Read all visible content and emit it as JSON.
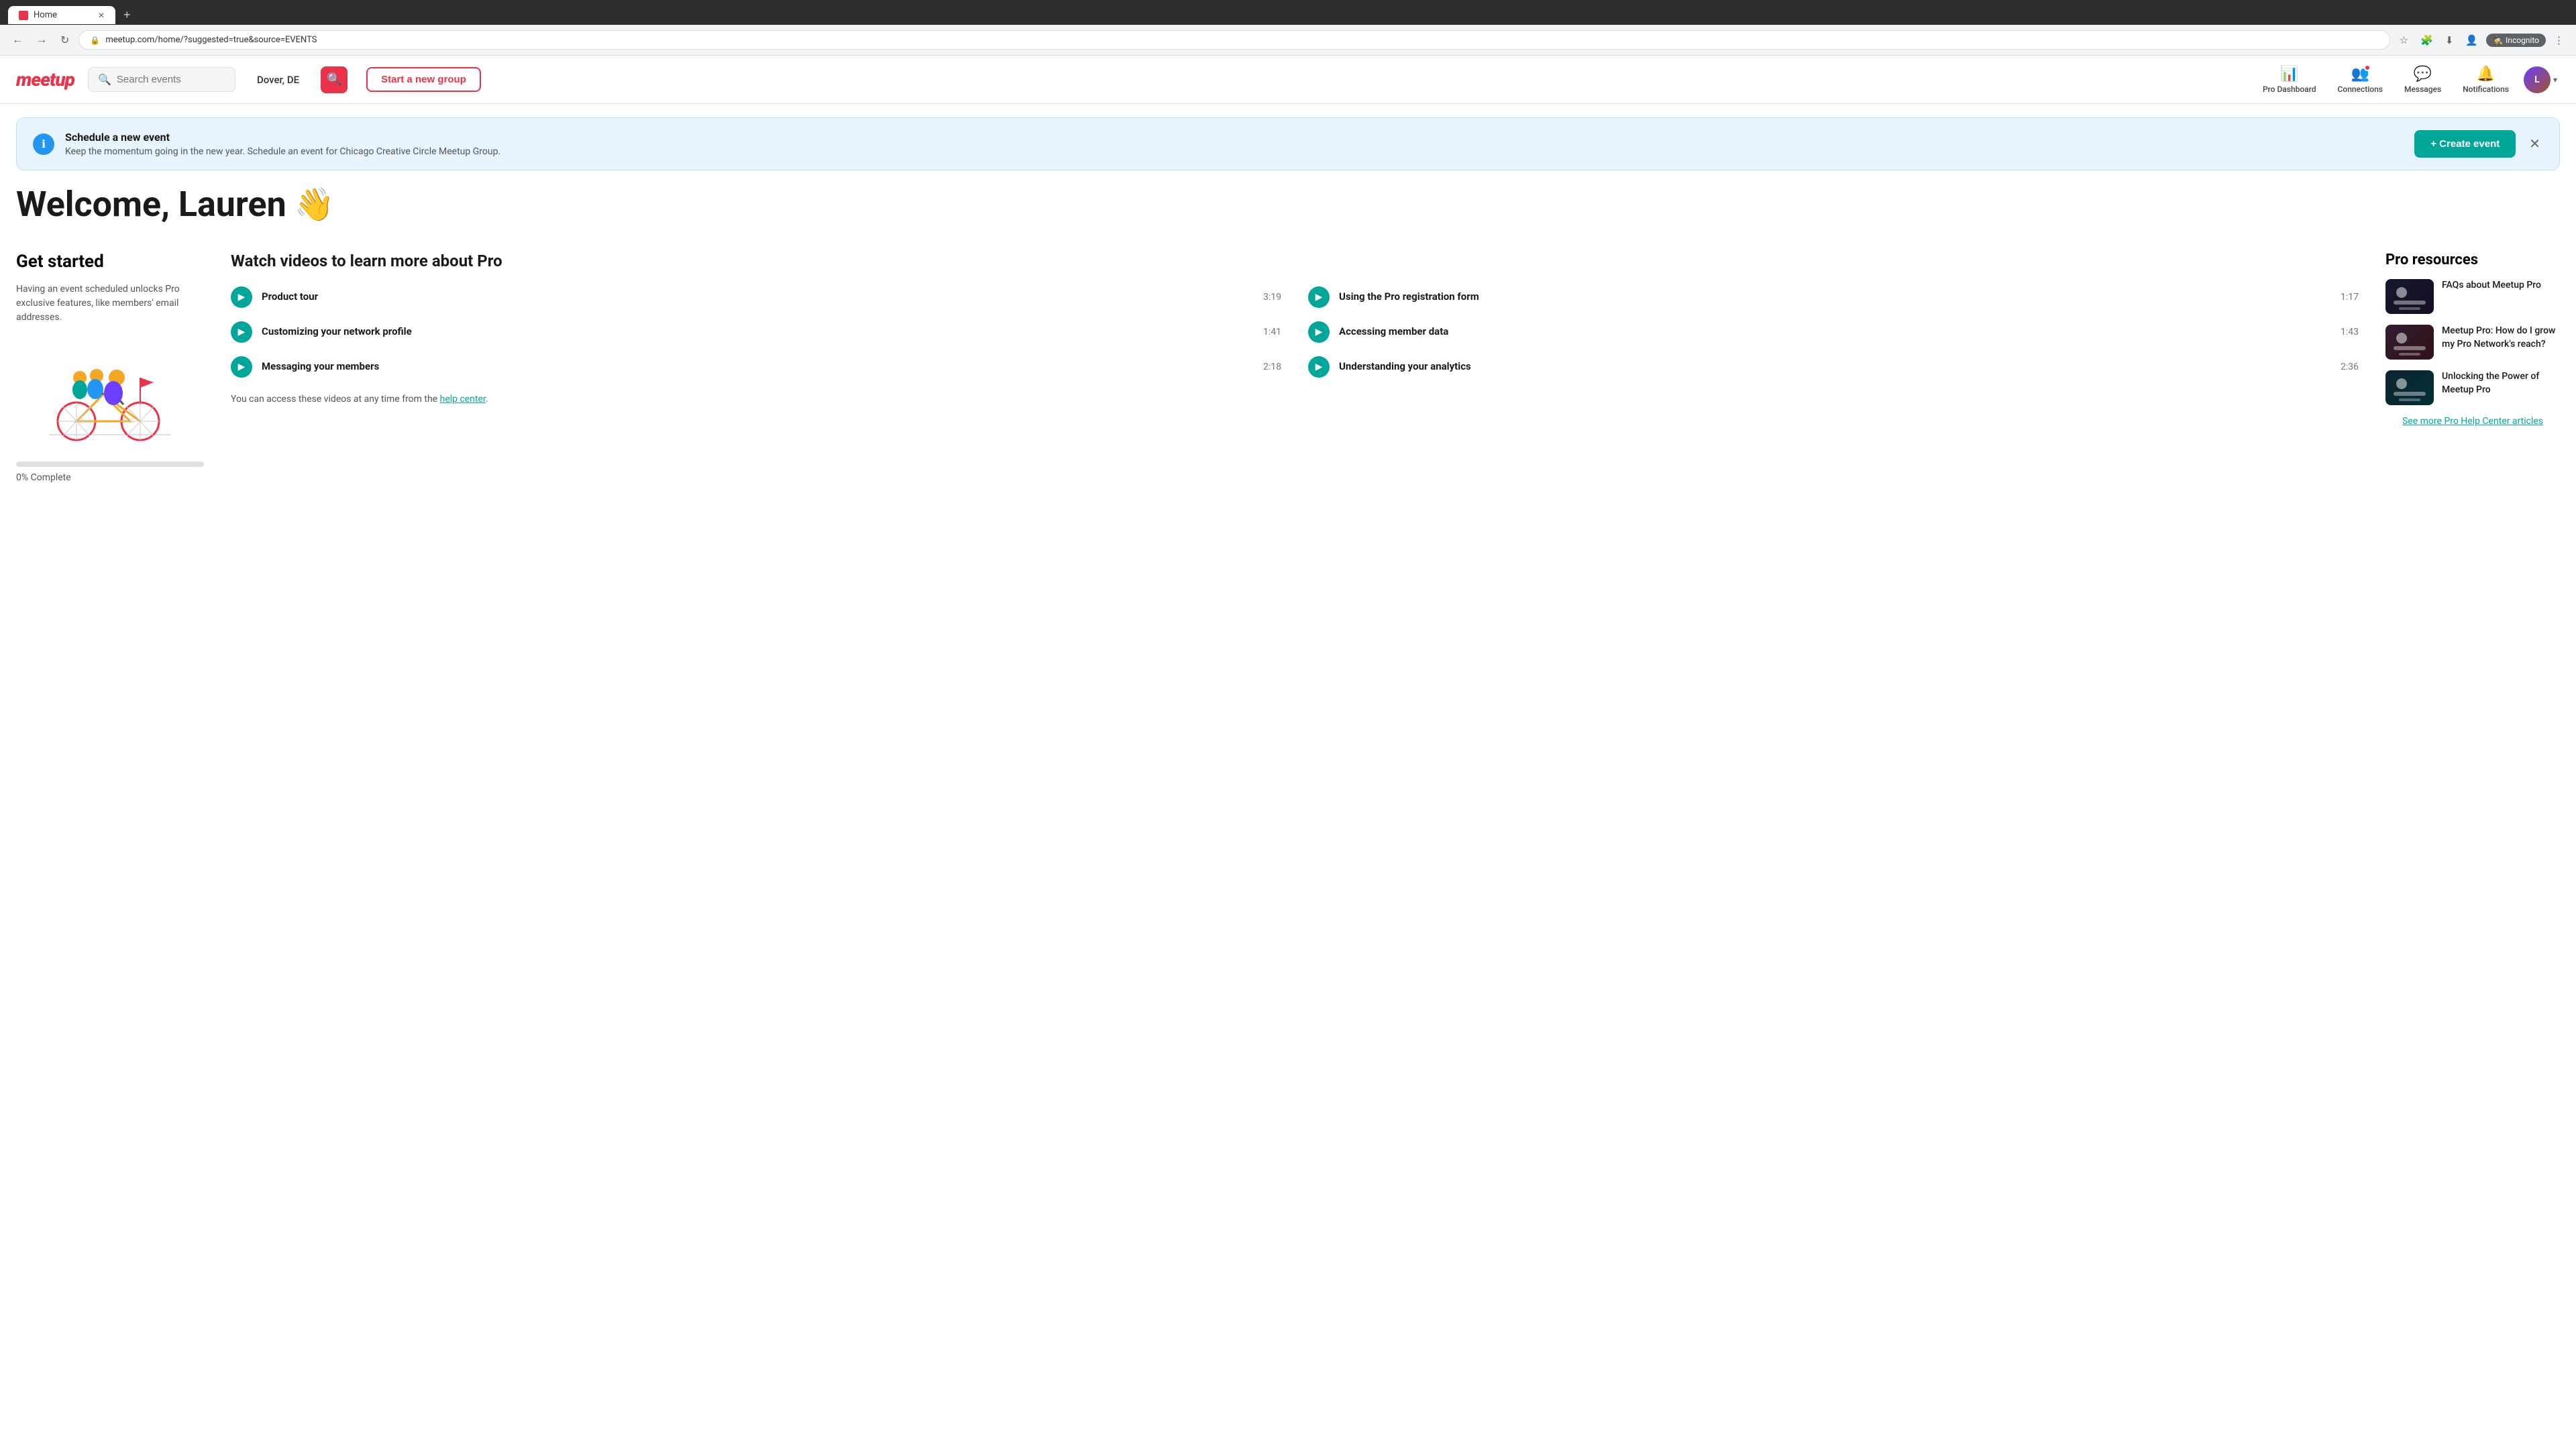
{
  "browser": {
    "tab_label": "Home",
    "tab_favicon": "meetup-favicon",
    "address": "meetup.com/home/?suggested=true&source=EVENTS",
    "mode": "Incognito"
  },
  "header": {
    "logo_text": "meetup",
    "search_placeholder": "Search events",
    "location": "Dover, DE",
    "search_button_icon": "🔍",
    "start_group_label": "Start a new group",
    "nav_items": [
      {
        "id": "pro-dashboard",
        "icon": "📊",
        "label": "Pro Dashboard",
        "has_dot": false
      },
      {
        "id": "connections",
        "icon": "👥",
        "label": "Connections",
        "has_dot": true
      },
      {
        "id": "messages",
        "icon": "💬",
        "label": "Messages",
        "has_dot": false
      },
      {
        "id": "notifications",
        "icon": "🔔",
        "label": "Notifications",
        "has_dot": false
      }
    ],
    "user_initials": "L"
  },
  "banner": {
    "icon": "ℹ",
    "title": "Schedule a new event",
    "body": "Keep the momentum going in the new year. Schedule an event for Chicago Creative Circle Meetup Group.",
    "create_label": "+ Create event",
    "close_icon": "✕"
  },
  "welcome": {
    "greeting": "Welcome, Lauren",
    "emoji": "👋"
  },
  "get_started": {
    "heading": "Get started",
    "body": "Having an event scheduled unlocks Pro exclusive features, like members' email addresses.",
    "progress_percent": 0,
    "progress_label": "0% Complete"
  },
  "videos": {
    "heading": "Watch videos to learn more about Pro",
    "items": [
      {
        "title": "Product tour",
        "duration": "3:19"
      },
      {
        "title": "Using the Pro registration form",
        "duration": "1:17"
      },
      {
        "title": "Customizing your network profile",
        "duration": "1:41"
      },
      {
        "title": "Accessing member data",
        "duration": "1:43"
      },
      {
        "title": "Messaging your members",
        "duration": "2:18"
      },
      {
        "title": "Understanding your analytics",
        "duration": "2:36"
      }
    ],
    "footer_prefix": "You can access these videos at any time from the ",
    "footer_link_text": "help center",
    "footer_suffix": "."
  },
  "pro_resources": {
    "heading": "Pro resources",
    "items": [
      {
        "text": "FAQs about Meetup Pro",
        "thumb_class": "thumb-1"
      },
      {
        "text": "Meetup Pro: How do I grow my Pro Network's reach?",
        "thumb_class": "thumb-2"
      },
      {
        "text": "Unlocking the Power of Meetup Pro",
        "thumb_class": "thumb-3"
      }
    ],
    "see_more_label": "See more Pro Help Center articles"
  }
}
